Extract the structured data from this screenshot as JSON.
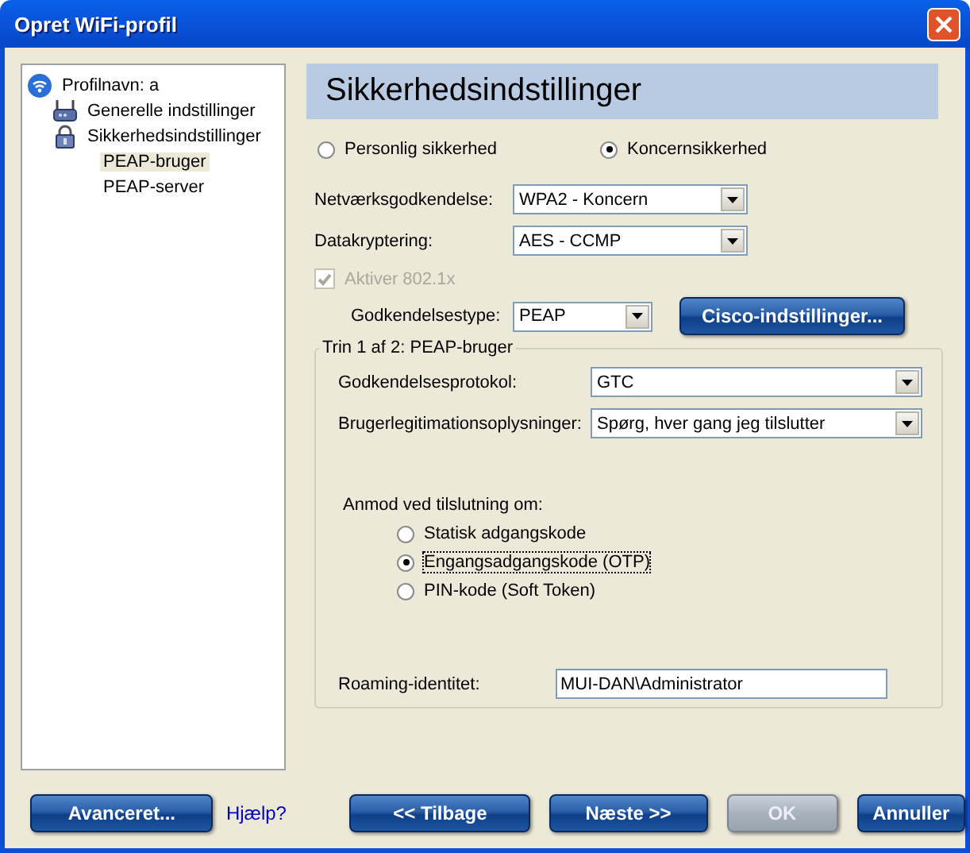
{
  "window": {
    "title": "Opret WiFi-profil"
  },
  "tree": [
    {
      "label": "Profilnavn: a",
      "kind": "wifi",
      "selected": false,
      "children": [
        {
          "label": "Generelle indstillinger",
          "kind": "router",
          "selected": false
        },
        {
          "label": "Sikkerhedsindstillinger",
          "kind": "lock",
          "selected": false,
          "children": [
            {
              "label": "PEAP-bruger",
              "selected": true
            },
            {
              "label": "PEAP-server",
              "selected": false
            }
          ]
        }
      ]
    }
  ],
  "heading": "Sikkerhedsindstillinger",
  "security_mode": [
    {
      "label": "Personlig sikkerhed",
      "selected": false
    },
    {
      "label": "Koncernsikkerhed",
      "selected": true
    }
  ],
  "network_auth": {
    "label": "Netværksgodkendelse:",
    "value": "WPA2 - Koncern"
  },
  "encryption": {
    "label": "Datakryptering:",
    "value": "AES - CCMP"
  },
  "enable_8021x": {
    "label": "Aktiver 802.1x",
    "checked": true,
    "disabled": true
  },
  "auth_type": {
    "label": "Godkendelsestype:",
    "value": "PEAP"
  },
  "cisco_button": {
    "label": "Cisco-indstillinger...",
    "disabled": false
  },
  "step_group": {
    "title": "Trin 1 af 2: PEAP-bruger",
    "protocol": {
      "label": "Godkendelsesprotokol:",
      "value": "GTC"
    },
    "credentials": {
      "label": "Brugerlegitimationsoplysninger:",
      "value": "Spørg, hver gang jeg tilslutter"
    },
    "prompt_label": "Anmod ved tilslutning om:",
    "prompt_options": [
      {
        "label": "Statisk adgangskode",
        "selected": false,
        "focused": false
      },
      {
        "label": "Engangsadgangskode (OTP)",
        "selected": true,
        "focused": true
      },
      {
        "label": "PIN-kode (Soft Token)",
        "selected": false,
        "focused": false
      }
    ],
    "roaming": {
      "label": "Roaming-identitet:",
      "value": "MUI-DAN\\Administrator"
    }
  },
  "footer": {
    "advanced": {
      "label": "Avanceret...",
      "disabled": false
    },
    "help_link": "Hjælp?",
    "nav_buttons": [
      {
        "label": "<< Tilbage",
        "disabled": false
      },
      {
        "label": "Næste >>",
        "disabled": false
      },
      {
        "label": "OK",
        "disabled": true
      },
      {
        "label": "Annuller",
        "disabled": false
      }
    ]
  }
}
